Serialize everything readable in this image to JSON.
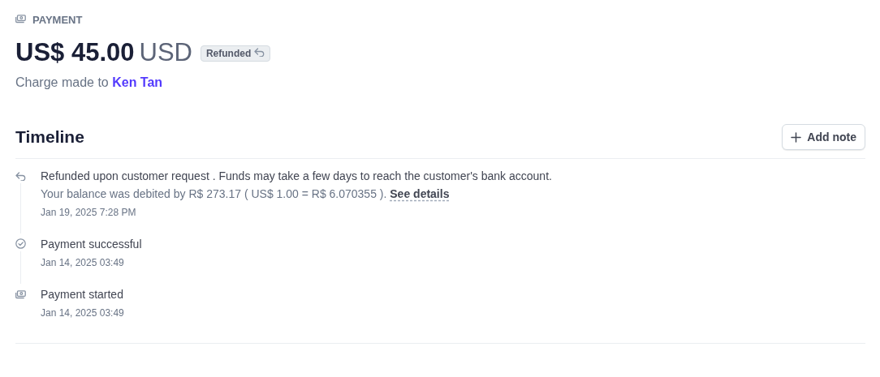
{
  "header": {
    "label": "PAYMENT",
    "amount": "US$ 45.00",
    "currency": "USD",
    "status_badge": "Refunded",
    "charge_prefix": "Charge made to",
    "customer": "Ken Tan"
  },
  "timeline": {
    "title": "Timeline",
    "add_button": "Add note",
    "events": [
      {
        "kind": "refund",
        "text": "Refunded upon customer request . Funds may take a few days to reach the customer's bank account.",
        "detail": "Your balance was debited by R$ 273.17 ( US$ 1.00 = R$ 6.070355 ).",
        "link": "See details",
        "date": "Jan 19, 2025 7:28 PM"
      },
      {
        "kind": "success",
        "text": "Payment successful",
        "date": "Jan 14, 2025 03:49"
      },
      {
        "kind": "started",
        "text": "Payment started",
        "date": "Jan 14, 2025 03:49"
      }
    ]
  }
}
